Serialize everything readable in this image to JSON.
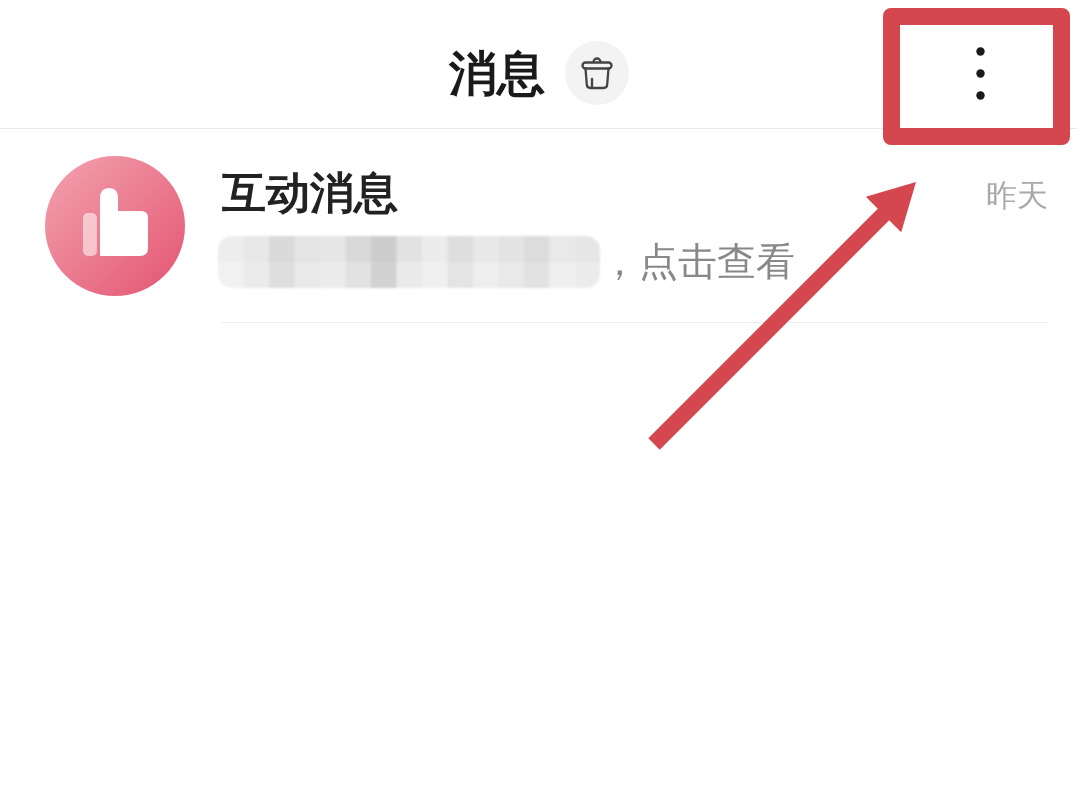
{
  "header": {
    "title": "消息"
  },
  "messages": [
    {
      "title": "互动消息",
      "redacted": true,
      "preview": "，点击查看",
      "time": "昨天"
    }
  ]
}
